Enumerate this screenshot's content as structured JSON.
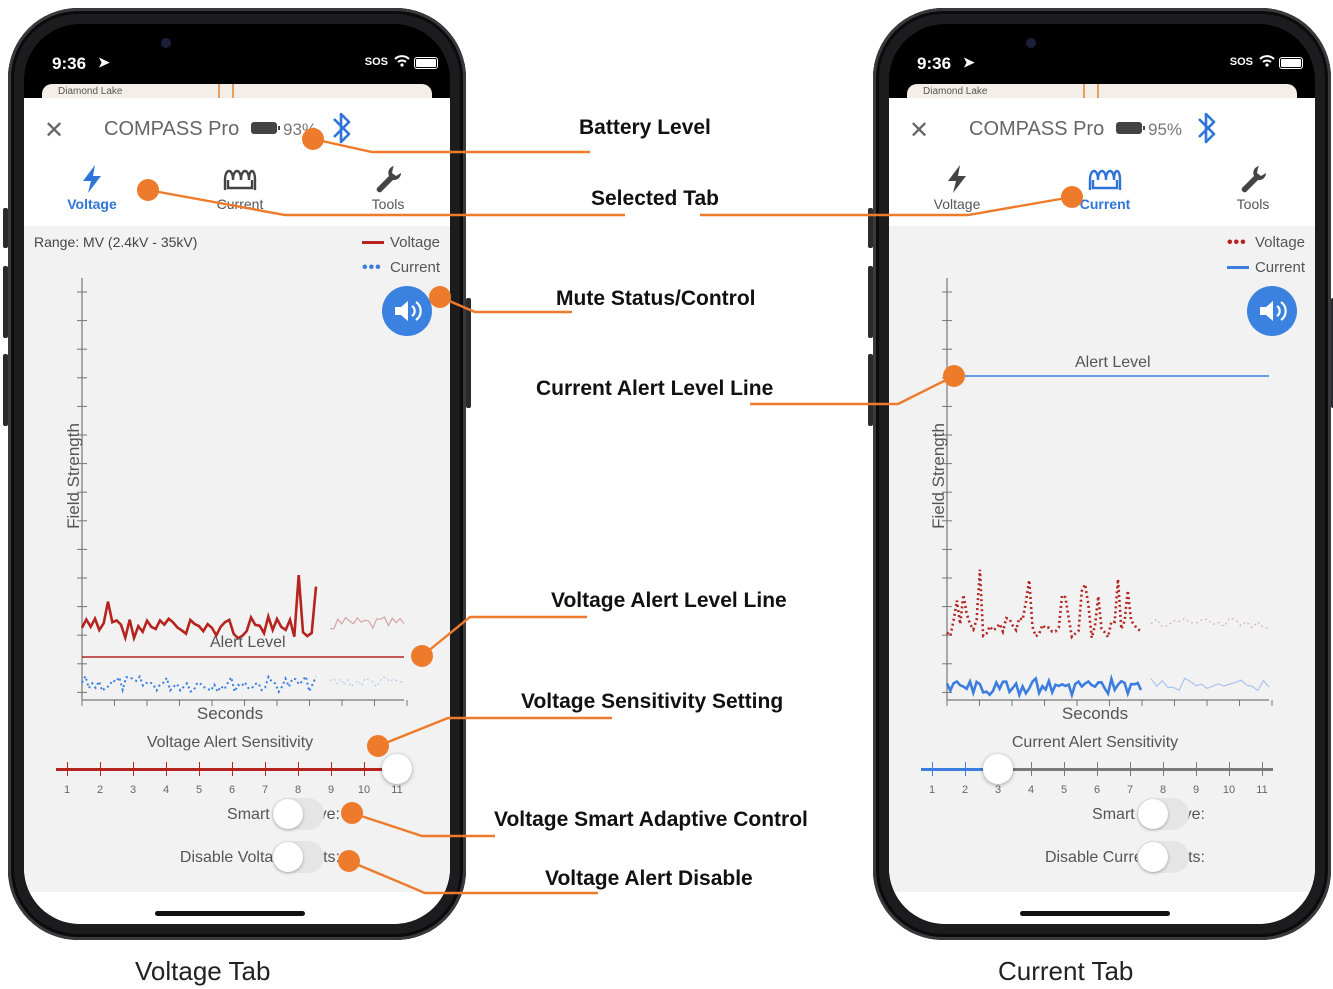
{
  "colors": {
    "accent": "#2f74d9",
    "voltage": "#b5241f",
    "current": "#3b7ee0",
    "callout": "#ee7b2b"
  },
  "status": {
    "time": "9:36",
    "sos": "SOS"
  },
  "map": {
    "place": "Diamond Lake"
  },
  "phones": [
    {
      "device": "COMPASS Pro",
      "battery": "93%",
      "tabs": [
        {
          "label": "Voltage",
          "icon": "lightning-icon",
          "active": true
        },
        {
          "label": "Current",
          "icon": "coil-icon",
          "active": false
        },
        {
          "label": "Tools",
          "icon": "wrench-icon",
          "active": false
        }
      ],
      "range": "Range: MV (2.4kV - 35kV)",
      "legend": [
        {
          "label": "Voltage",
          "style": "solid"
        },
        {
          "label": "Current",
          "style": "dotted"
        }
      ],
      "y_label": "Field Strength",
      "x_label": "Seconds",
      "alert_label": "Alert Level",
      "sensitivity_title": "Voltage Alert Sensitivity",
      "slider": {
        "ticks": [
          "1",
          "2",
          "3",
          "4",
          "5",
          "6",
          "7",
          "8",
          "9",
          "10",
          "11"
        ],
        "value": 11
      },
      "toggles": [
        {
          "label": "Smart Adaptive:",
          "on": false
        },
        {
          "label": "Disable Voltage Alerts:",
          "on": false
        }
      ],
      "caption": "Voltage Tab"
    },
    {
      "device": "COMPASS Pro",
      "battery": "95%",
      "tabs": [
        {
          "label": "Voltage",
          "icon": "lightning-icon",
          "active": false
        },
        {
          "label": "Current",
          "icon": "coil-icon",
          "active": true
        },
        {
          "label": "Tools",
          "icon": "wrench-icon",
          "active": false
        }
      ],
      "range": "",
      "legend": [
        {
          "label": "Voltage",
          "style": "dotted"
        },
        {
          "label": "Current",
          "style": "solid"
        }
      ],
      "y_label": "Field Strength",
      "x_label": "Seconds",
      "alert_label": "Alert Level",
      "sensitivity_title": "Current Alert Sensitivity",
      "slider": {
        "ticks": [
          "1",
          "2",
          "3",
          "4",
          "5",
          "6",
          "7",
          "8",
          "9",
          "10",
          "11"
        ],
        "value": 3
      },
      "toggles": [
        {
          "label": "Smart Adaptive:",
          "on": false
        },
        {
          "label": "Disable Current Alerts:",
          "on": false
        }
      ],
      "caption": "Current Tab"
    }
  ],
  "callouts": {
    "battery": "Battery Level",
    "selected_tab": "Selected Tab",
    "mute": "Mute Status/Control",
    "current_alert_line": "Current Alert Level Line",
    "voltage_alert_line": "Voltage Alert Level Line",
    "voltage_sensitivity": "Voltage Sensitivity Setting",
    "voltage_smart": "Voltage Smart Adaptive Control",
    "voltage_disable": "Voltage Alert Disable"
  }
}
